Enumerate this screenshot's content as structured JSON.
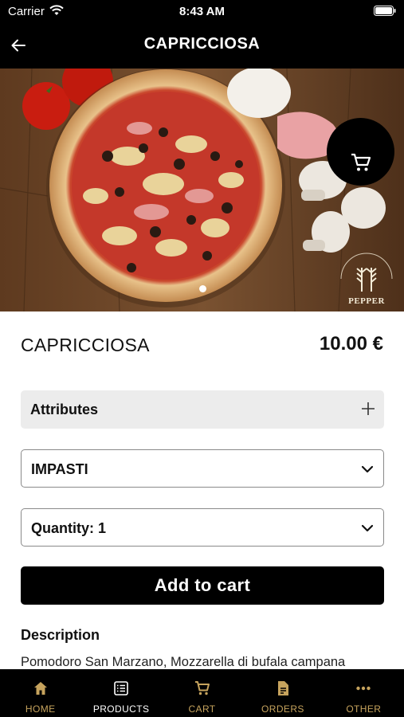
{
  "status_bar": {
    "carrier": "Carrier",
    "time": "8:43 AM"
  },
  "nav": {
    "title": "CAPRICCIOSA",
    "back_icon": "arrow-left-icon"
  },
  "hero": {
    "cart_icon": "cart-icon",
    "brand_name": "PEPPER",
    "slide_count": 1,
    "current_slide": 1
  },
  "product": {
    "name": "CAPRICCIOSA",
    "price": "10.00 €"
  },
  "attributes": {
    "label": "Attributes",
    "icon": "plus-icon"
  },
  "dough_select": {
    "label": "IMPASTI"
  },
  "quantity_select": {
    "label": "Quantity: 1"
  },
  "add_to_cart": {
    "label": "Add to cart"
  },
  "description": {
    "heading": "Description",
    "text": "Pomodoro San Marzano, Mozzarella di bufala campana"
  },
  "tabs": [
    {
      "label": "HOME",
      "icon": "home-icon",
      "active": false
    },
    {
      "label": "PRODUCTS",
      "icon": "list-icon",
      "active": true
    },
    {
      "label": "CART",
      "icon": "cart-icon",
      "active": false
    },
    {
      "label": "ORDERS",
      "icon": "document-icon",
      "active": false
    },
    {
      "label": "OTHER",
      "icon": "more-icon",
      "active": false
    }
  ],
  "colors": {
    "bar_background": "#000000",
    "tab_accent": "#c6a35d",
    "tab_active": "#ffffff",
    "attributes_bg": "#ececec"
  }
}
